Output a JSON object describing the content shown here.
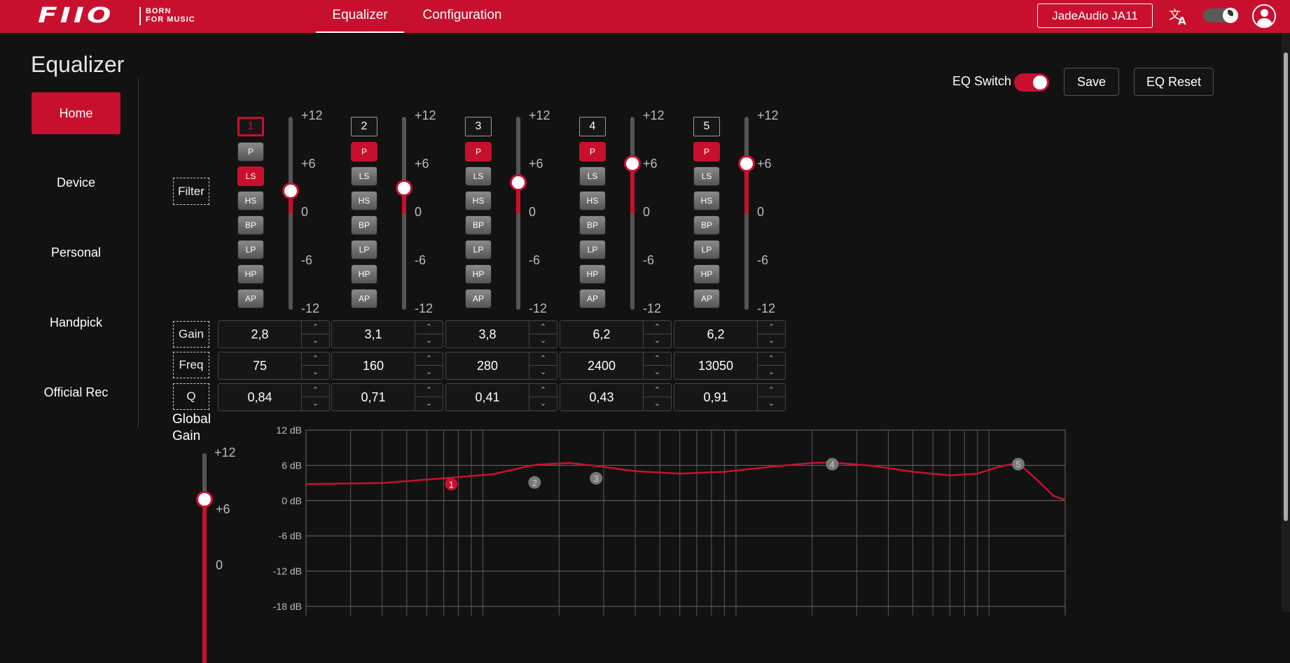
{
  "header": {
    "logo_text": "FIIO",
    "logo_tagline_1": "BORN",
    "logo_tagline_2": "FOR MUSIC",
    "tabs": [
      {
        "label": "Equalizer",
        "active": true
      },
      {
        "label": "Configuration",
        "active": false
      }
    ],
    "device_button": "JadeAudio JA11",
    "accent_color": "#c8102e"
  },
  "page_title": "Equalizer",
  "sidebar": {
    "items": [
      {
        "label": "Home",
        "active": true
      },
      {
        "label": "Device",
        "active": false
      },
      {
        "label": "Personal",
        "active": false
      },
      {
        "label": "Handpick",
        "active": false
      },
      {
        "label": "Official Rec",
        "active": false
      }
    ]
  },
  "controls": {
    "eq_switch_label": "EQ Switch",
    "eq_switch_on": true,
    "save_label": "Save",
    "reset_label": "EQ Reset"
  },
  "row_labels": {
    "filter": "Filter",
    "gain": "Gain",
    "freq": "Freq",
    "q": "Q"
  },
  "filter_types": [
    "P",
    "LS",
    "HS",
    "BP",
    "LP",
    "HP",
    "AP"
  ],
  "gain_scale": [
    "+12",
    "+6",
    "0",
    "-6",
    "-12"
  ],
  "bands": [
    {
      "number": "1",
      "filter": "LS",
      "gain": "2,8",
      "freq": "75",
      "q": "0,84",
      "gain_value": 2.8,
      "selected": true
    },
    {
      "number": "2",
      "filter": "P",
      "gain": "3,1",
      "freq": "160",
      "q": "0,71",
      "gain_value": 3.1,
      "selected": false
    },
    {
      "number": "3",
      "filter": "P",
      "gain": "3,8",
      "freq": "280",
      "q": "0,41",
      "gain_value": 3.8,
      "selected": false
    },
    {
      "number": "4",
      "filter": "P",
      "gain": "6,2",
      "freq": "2400",
      "q": "0,43",
      "gain_value": 6.2,
      "selected": false
    },
    {
      "number": "5",
      "filter": "P",
      "gain": "6,2",
      "freq": "13050",
      "q": "0,91",
      "gain_value": 6.2,
      "selected": false
    }
  ],
  "global_gain": {
    "label_1": "Global",
    "label_2": "Gain",
    "scale": [
      "+12",
      "+6",
      "0"
    ],
    "value": 6
  },
  "chart_data": {
    "type": "line",
    "ylim": [
      -18,
      12
    ],
    "yticks": [
      "12 dB",
      "6 dB",
      "0 dB",
      "-6 dB",
      "-12 dB",
      "-18 dB"
    ],
    "x_scale": "log",
    "xlim": [
      20,
      20000
    ],
    "grid": true,
    "series": [
      {
        "x": [
          20,
          40,
          75,
          110,
          160,
          220,
          280,
          400,
          600,
          900,
          1400,
          2000,
          2400,
          3500,
          5000,
          7000,
          9000,
          11000,
          13050,
          15500,
          18000,
          20000
        ],
        "y": [
          2.8,
          3.0,
          3.9,
          4.5,
          6.1,
          6.4,
          5.9,
          5.0,
          4.6,
          4.9,
          5.8,
          6.4,
          6.5,
          5.9,
          4.9,
          4.3,
          4.6,
          5.8,
          6.4,
          3.5,
          0.8,
          0.1
        ]
      }
    ],
    "markers": [
      {
        "label": "1",
        "x": 75,
        "y": 2.8,
        "selected": true
      },
      {
        "label": "2",
        "x": 160,
        "y": 3.1,
        "selected": false
      },
      {
        "label": "3",
        "x": 280,
        "y": 3.8,
        "selected": false
      },
      {
        "label": "4",
        "x": 2400,
        "y": 6.2,
        "selected": false
      },
      {
        "label": "5",
        "x": 13050,
        "y": 6.2,
        "selected": false
      }
    ]
  }
}
